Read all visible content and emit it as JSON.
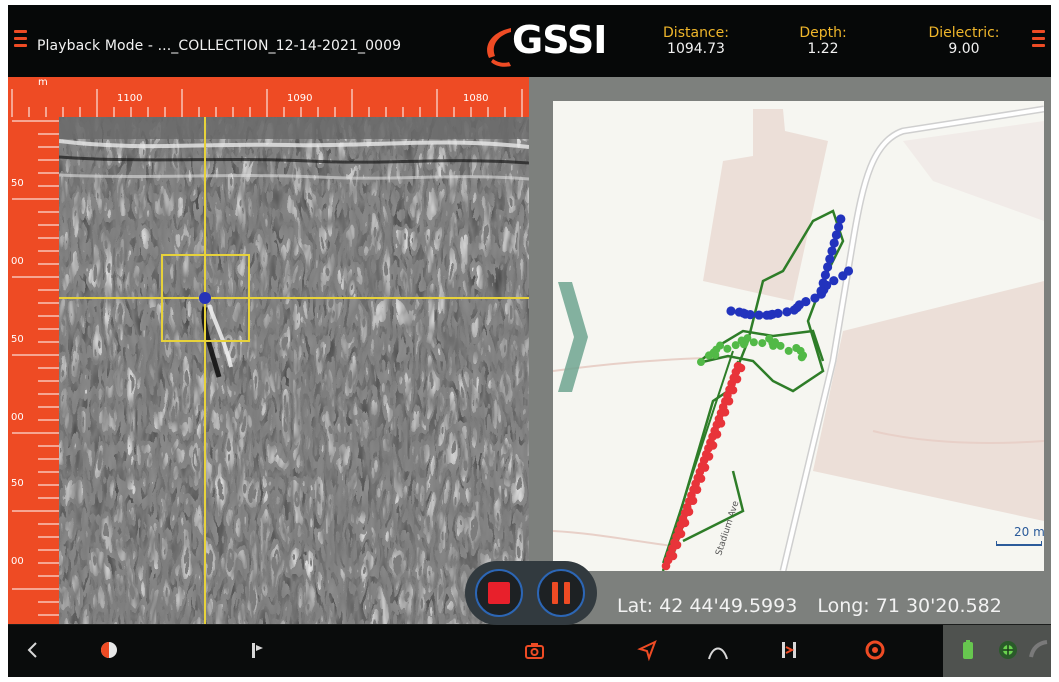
{
  "header": {
    "title": "Playback Mode - ..._COLLECTION_12-14-2021_0009",
    "logo": "GSSI",
    "stats": [
      {
        "label": "Distance:",
        "value": "1094.73"
      },
      {
        "label": "Depth:",
        "value": "1.22"
      },
      {
        "label": "Dielectric:",
        "value": "9.00"
      }
    ]
  },
  "ruler": {
    "unit": "m",
    "top_ticks": [
      "1100",
      "1090",
      "1080"
    ],
    "left_ticks": [
      "50",
      "00",
      "50",
      "00",
      "50",
      "00"
    ]
  },
  "map": {
    "street_label": "Stadium Ave",
    "scale_label": "20 m",
    "latitude": "Lat: 42 44'49.5993",
    "longitude": "Long: 71 30'20.582"
  },
  "icons": {
    "left_menu": "hamburger-menu-icon",
    "right_menu": "hamburger-menu-icon",
    "back": "chevron-left-icon",
    "contrast": "contrast-icon",
    "marker": "flag-marker-icon",
    "camera": "camera-icon",
    "navigate": "navigation-arrow-icon",
    "hyperbola": "hyperbola-icon",
    "filter": "filter-icon",
    "target": "target-icon",
    "battery": "battery-icon",
    "gps": "gps-status-icon"
  },
  "colors": {
    "accent": "#ee4b24",
    "label": "#efb62b",
    "crosshair": "#e7d23a",
    "record_stop": "#e8202b",
    "track_red": "#e8343a",
    "track_green": "#52b947",
    "track_blue": "#2233bd"
  }
}
